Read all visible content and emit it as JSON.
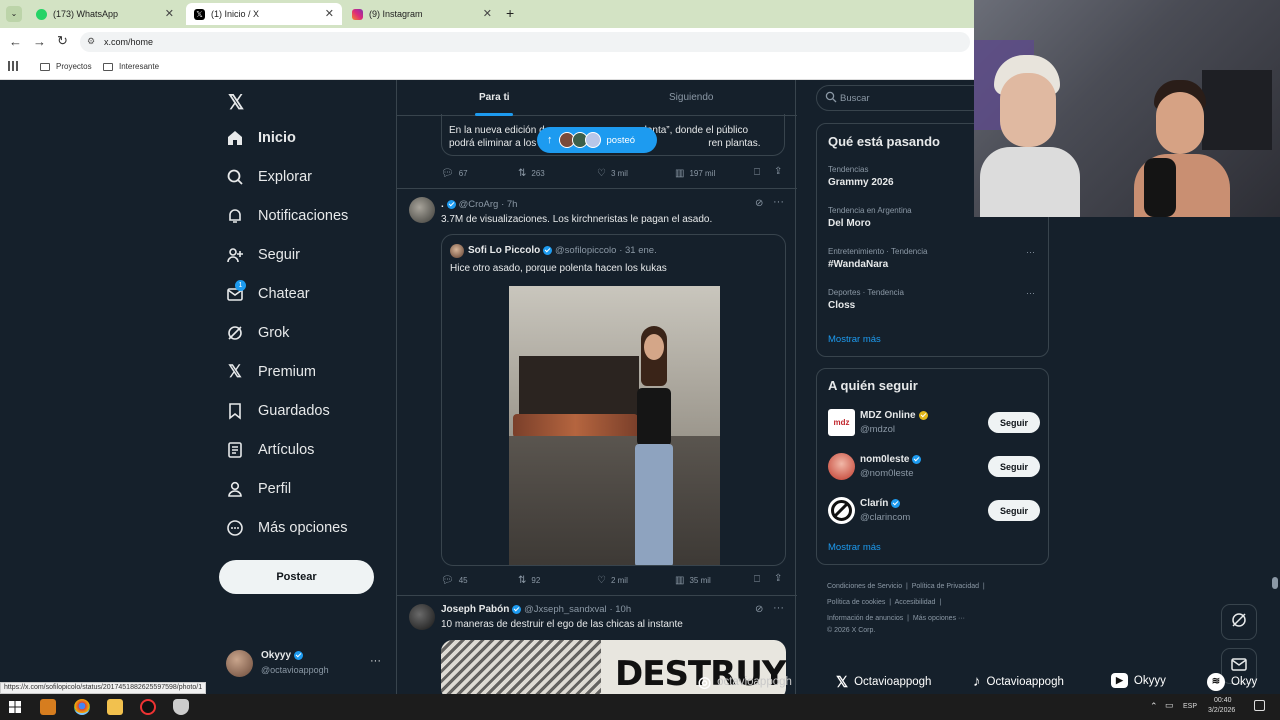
{
  "browser": {
    "tabs": [
      {
        "title": "(173) WhatsApp",
        "icon": "whatsapp-icon"
      },
      {
        "title": "(1) Inicio / X",
        "icon": "x-logo-icon"
      },
      {
        "title": "(9) Instagram",
        "icon": "instagram-icon"
      }
    ],
    "url": "x.com/home",
    "bookmarks": [
      "Proyectos",
      "Interesante"
    ],
    "status_url": "https://x.com/sofilopicolo/status/2017451882625597598/photo/1"
  },
  "sidebar": {
    "items": [
      {
        "label": "Inicio",
        "icon": "home-icon"
      },
      {
        "label": "Explorar",
        "icon": "search-icon"
      },
      {
        "label": "Notificaciones",
        "icon": "bell-icon"
      },
      {
        "label": "Seguir",
        "icon": "add-person-icon"
      },
      {
        "label": "Chatear",
        "icon": "mail-icon",
        "badge": "1"
      },
      {
        "label": "Grok",
        "icon": "grok-icon"
      },
      {
        "label": "Premium",
        "icon": "x-logo-icon"
      },
      {
        "label": "Guardados",
        "icon": "bookmark-icon"
      },
      {
        "label": "Artículos",
        "icon": "article-icon"
      },
      {
        "label": "Perfil",
        "icon": "person-icon"
      },
      {
        "label": "Más opciones",
        "icon": "more-circle-icon"
      }
    ],
    "post_button": "Postear",
    "account": {
      "name": "Okyyy",
      "handle": "@octavioappogh"
    }
  },
  "feed": {
    "tabs": [
      "Para ti",
      "Siguiendo"
    ],
    "new_posts_pill": "posteó",
    "post1": {
      "text_line1": "En la nueva edición d",
      "text_line1_end": "lanta”, donde el público",
      "text_line2": "podrá eliminar a los",
      "text_line2_end": "ren plantas.",
      "replies": "67",
      "reposts": "263",
      "likes": "3 mil",
      "views": "197 mil"
    },
    "post2": {
      "name": ".",
      "handle": "@CroArg",
      "time": "· 7h",
      "text": "3.7M de visualizaciones. Los kirchneristas le pagan el asado.",
      "quote": {
        "name": "Sofi Lo Piccolo",
        "handle": "@sofilopiccolo",
        "time": "· 31 ene.",
        "text": "Hice otro asado, porque polenta hacen los kukas"
      },
      "replies": "45",
      "reposts": "92",
      "likes": "2 mil",
      "views": "35 mil"
    },
    "post3": {
      "name": "Joseph Pabón",
      "handle": "@Jxseph_sandxval",
      "time": "· 10h",
      "text": "10 maneras de destruir el ego de las chicas al instante",
      "image_text": "DESTRUYE"
    }
  },
  "right": {
    "search_placeholder": "Buscar",
    "trends_title": "Qué está pasando",
    "trends": [
      {
        "meta": "Tendencias",
        "name": "Grammy 2026"
      },
      {
        "meta": "Tendencia en Argentina",
        "name": "Del Moro"
      },
      {
        "meta": "Entretenimiento · Tendencia",
        "name": "#WandaNara"
      },
      {
        "meta": "Deportes · Tendencia",
        "name": "Closs"
      }
    ],
    "trends_more": "Mostrar más",
    "follow_title": "A quién seguir",
    "follow": [
      {
        "name": "MDZ Online",
        "handle": "@mdzol",
        "badge": "gold",
        "logo": "mdz"
      },
      {
        "name": "nom0leste",
        "handle": "@nom0leste",
        "badge": "blue",
        "logo": ""
      },
      {
        "name": "Clarín",
        "handle": "@clarincom",
        "badge": "blue",
        "logo": ""
      }
    ],
    "follow_button": "Seguir",
    "follow_more": "Mostrar más",
    "footer": [
      "Condiciones de Servicio",
      "Política de Privacidad",
      "Política de cookies",
      "Accesibilidad",
      "Información de anuncios",
      "Más opciones ···",
      "© 2026 X Corp."
    ]
  },
  "overlay_socials": [
    {
      "icon": "instagram-icon",
      "label": "octavioappogh"
    },
    {
      "icon": "x-logo-icon",
      "label": "Octavioappogh"
    },
    {
      "icon": "tiktok-icon",
      "label": "Octavioappogh"
    },
    {
      "icon": "youtube-icon",
      "label": "Okyyy"
    },
    {
      "icon": "spotify-icon",
      "label": "Okyy"
    }
  ],
  "taskbar": {
    "lang": "ESP",
    "time": "00:40",
    "date": "3/2/2026"
  },
  "colors": {
    "page_bg": "#15202b",
    "accent": "#1d9bf0",
    "border": "#38444d",
    "tab_bar": "#d3e3c4"
  }
}
